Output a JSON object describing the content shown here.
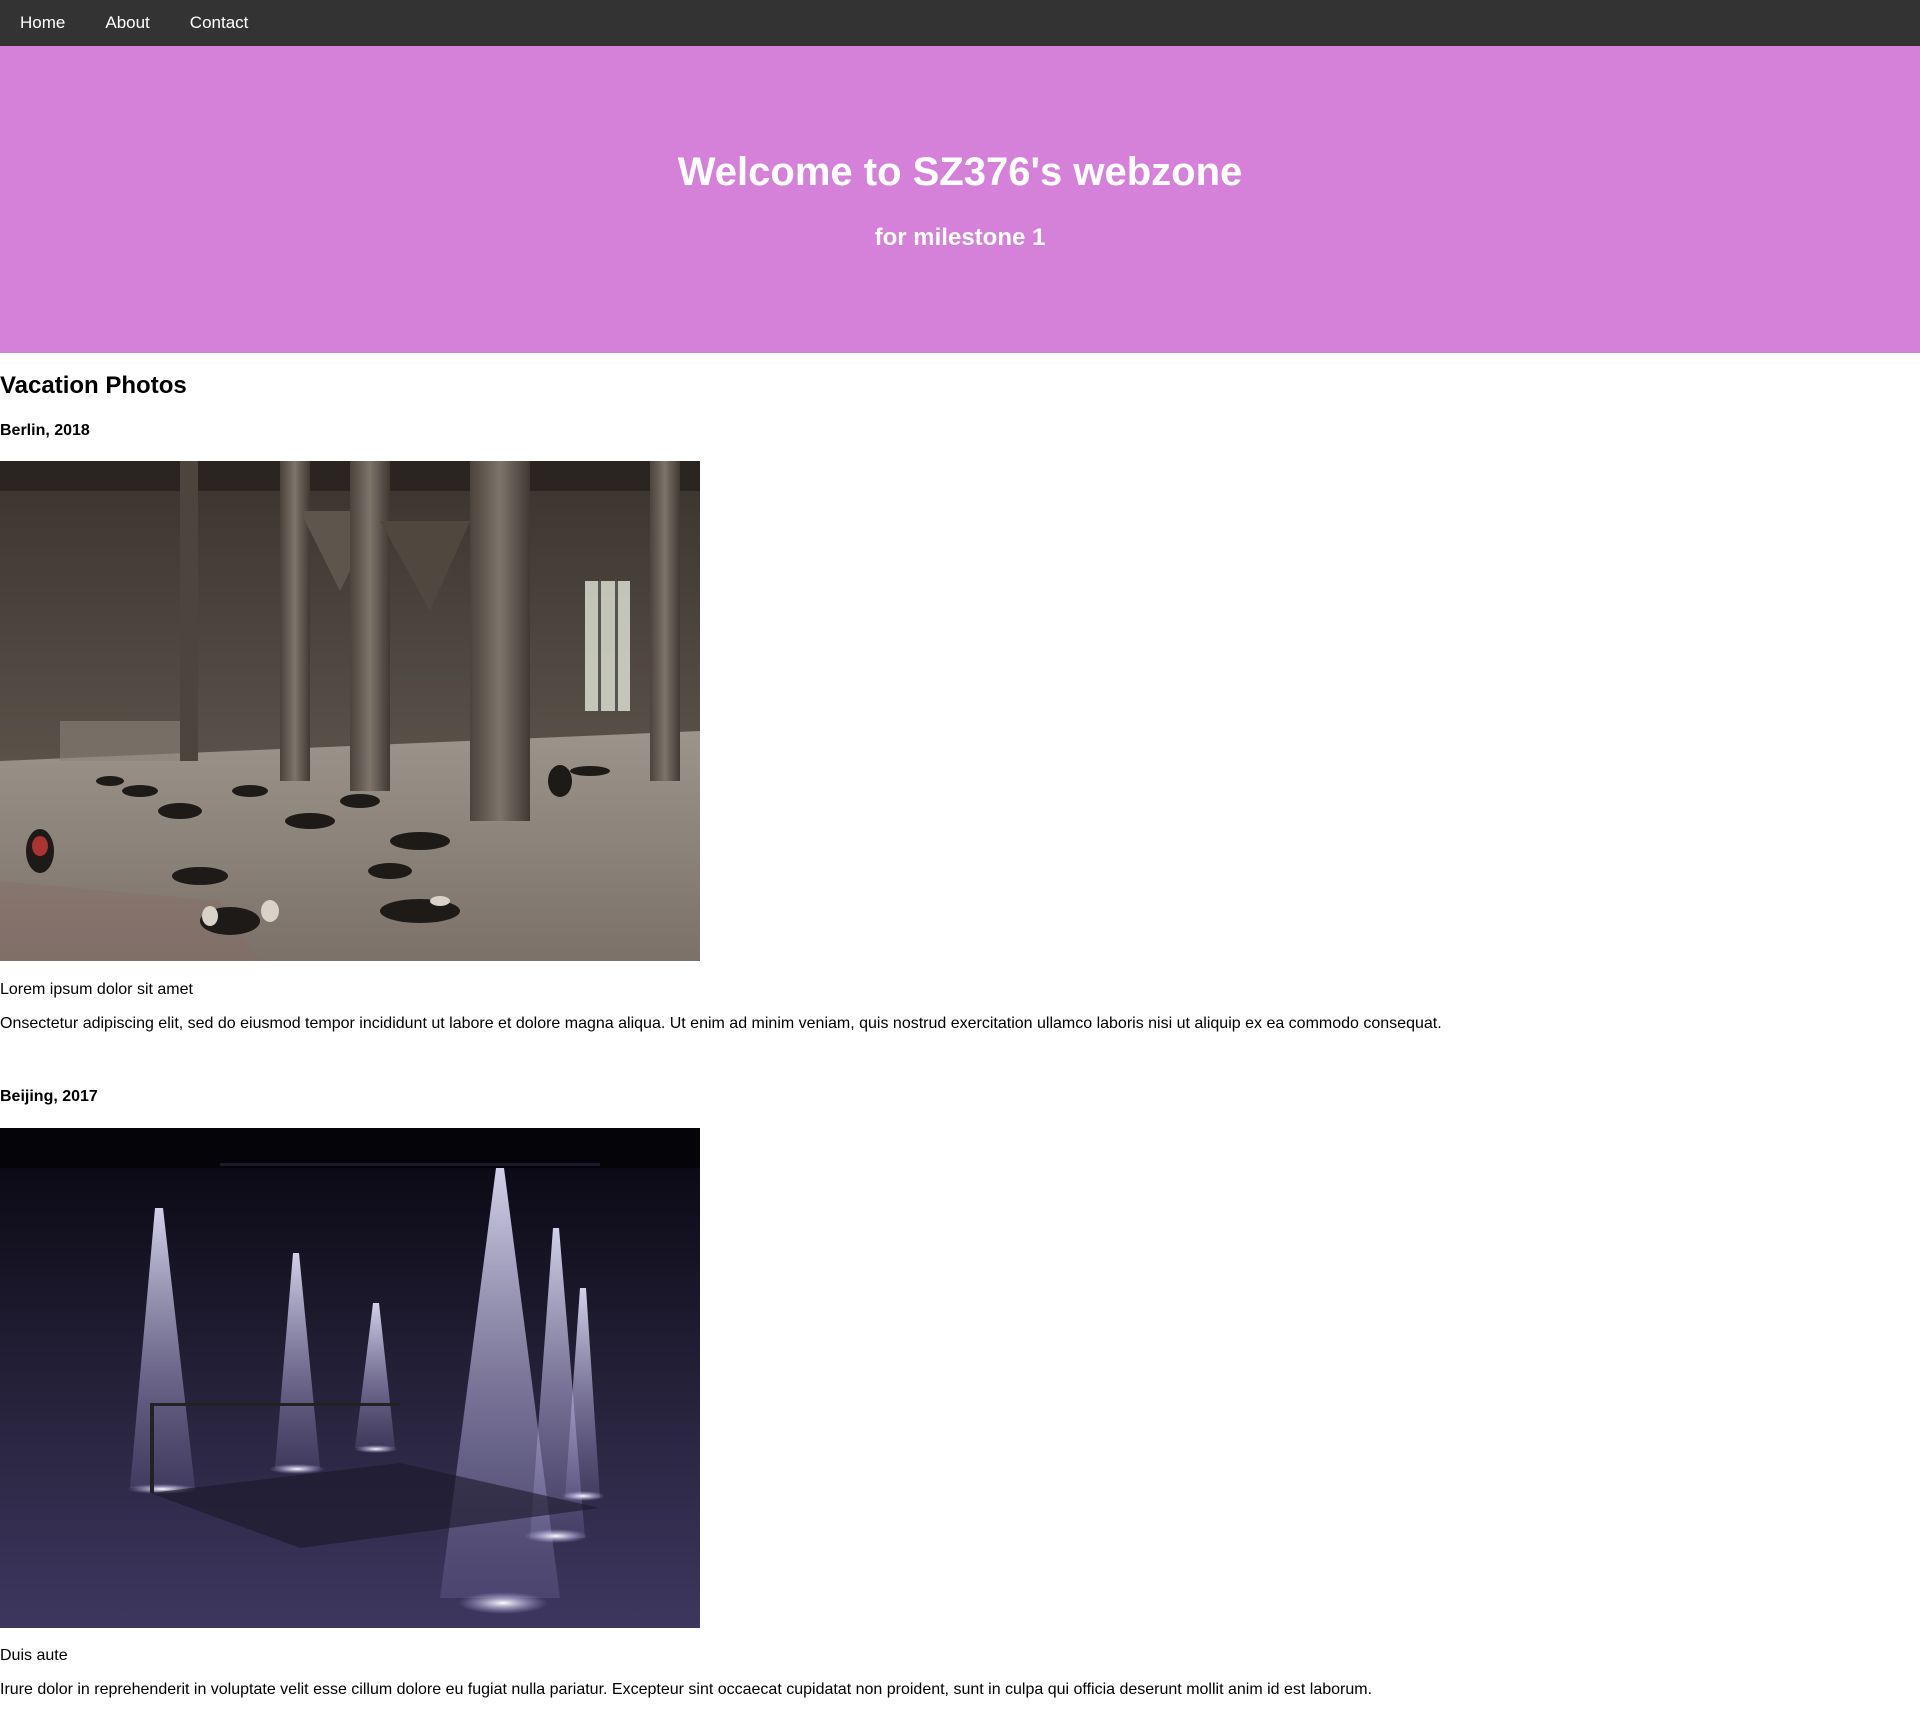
{
  "nav": {
    "items": [
      {
        "label": "Home"
      },
      {
        "label": "About"
      },
      {
        "label": "Contact"
      }
    ]
  },
  "hero": {
    "title": "Welcome to SZ376's webzone",
    "subtitle": "for milestone 1",
    "background_color": "#d580d9"
  },
  "main": {
    "section_title": "Vacation Photos",
    "entries": [
      {
        "title": "Berlin, 2018",
        "photo_description": "industrial concrete hall with people lying on the floor",
        "caption": "Lorem ipsum dolor sit amet",
        "text": "Onsectetur adipiscing elit, sed do eiusmod tempor incididunt ut labore et dolore magna aliqua. Ut enim ad minim veniam, quis nostrud exercitation ullamco laboris nisi ut aliquip ex ea commodo consequat."
      },
      {
        "title": "Beijing, 2017",
        "photo_description": "dark hall with purple spotlight beams",
        "caption": "Duis aute",
        "text": "Irure dolor in reprehenderit in voluptate velit esse cillum dolore eu fugiat nulla pariatur. Excepteur sint occaecat cupidatat non proident, sunt in culpa qui officia deserunt mollit anim id est laborum."
      }
    ]
  }
}
